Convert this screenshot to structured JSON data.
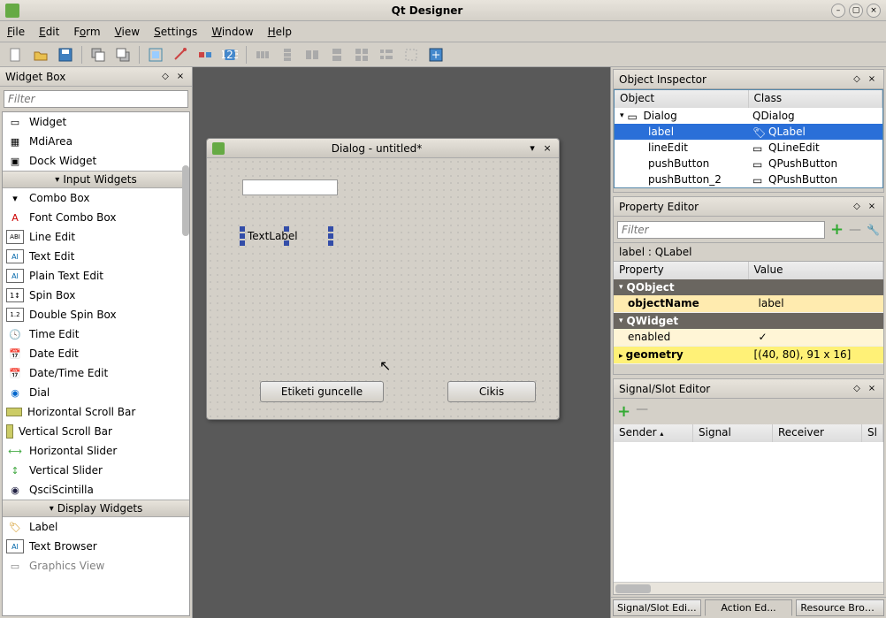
{
  "app": {
    "title": "Qt Designer"
  },
  "menu": {
    "file": "File",
    "edit": "Edit",
    "form": "Form",
    "view": "View",
    "settings": "Settings",
    "window": "Window",
    "help": "Help"
  },
  "widgetbox": {
    "title": "Widget Box",
    "filter_placeholder": "Filter",
    "items_top": [
      {
        "label": "Widget"
      },
      {
        "label": "MdiArea"
      },
      {
        "label": "Dock Widget"
      }
    ],
    "cat_input": "Input Widgets",
    "items_input": [
      {
        "label": "Combo Box"
      },
      {
        "label": "Font Combo Box"
      },
      {
        "label": "Line Edit"
      },
      {
        "label": "Text Edit"
      },
      {
        "label": "Plain Text Edit"
      },
      {
        "label": "Spin Box"
      },
      {
        "label": "Double Spin Box"
      },
      {
        "label": "Time Edit"
      },
      {
        "label": "Date Edit"
      },
      {
        "label": "Date/Time Edit"
      },
      {
        "label": "Dial"
      },
      {
        "label": "Horizontal Scroll Bar"
      },
      {
        "label": "Vertical Scroll Bar"
      },
      {
        "label": "Horizontal Slider"
      },
      {
        "label": "Vertical Slider"
      },
      {
        "label": "QsciScintilla"
      }
    ],
    "cat_display": "Display Widgets",
    "items_display": [
      {
        "label": "Label"
      },
      {
        "label": "Text Browser"
      },
      {
        "label": "Graphics View"
      }
    ]
  },
  "dialog": {
    "title": "Dialog - untitled*",
    "label_text": "TextLabel",
    "button1": "Etiketi guncelle",
    "button2": "Cikis"
  },
  "inspector": {
    "title": "Object Inspector",
    "col1": "Object",
    "col2": "Class",
    "rows": [
      {
        "obj": "Dialog",
        "cls": "QDialog",
        "indent": 0
      },
      {
        "obj": "label",
        "cls": "QLabel",
        "indent": 1,
        "sel": true
      },
      {
        "obj": "lineEdit",
        "cls": "QLineEdit",
        "indent": 1
      },
      {
        "obj": "pushButton",
        "cls": "QPushButton",
        "indent": 1
      },
      {
        "obj": "pushButton_2",
        "cls": "QPushButton",
        "indent": 1
      }
    ]
  },
  "propeditor": {
    "title": "Property Editor",
    "filter_placeholder": "Filter",
    "crumb": "label : QLabel",
    "col1": "Property",
    "col2": "Value",
    "cat_qobject": "QObject",
    "row_objname_k": "objectName",
    "row_objname_v": "label",
    "cat_qwidget": "QWidget",
    "row_enabled_k": "enabled",
    "row_geom_k": "geometry",
    "row_geom_v": "[(40, 80), 91 x 16]"
  },
  "sigslot": {
    "title": "Signal/Slot Editor",
    "col_sender": "Sender",
    "col_signal": "Signal",
    "col_receiver": "Receiver",
    "col_sl": "Sl"
  },
  "tabs": {
    "t1": "Signal/Slot Edi...",
    "t2": "Action Ed...",
    "t3": "Resource Brow..."
  }
}
